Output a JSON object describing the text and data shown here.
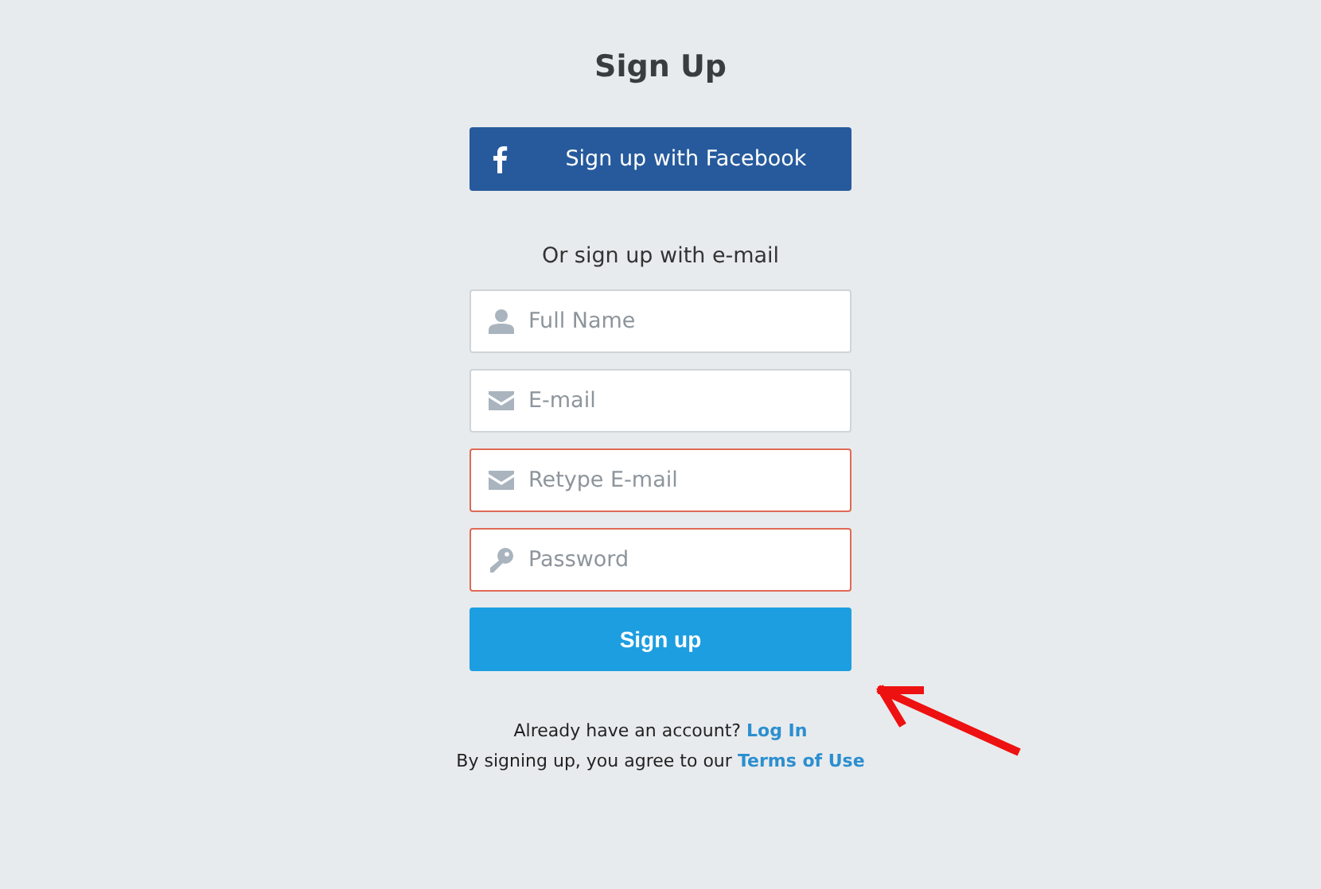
{
  "title": "Sign Up",
  "facebook_button": {
    "kind": "facebook",
    "label": "Sign up with Facebook"
  },
  "divider_text": "Or sign up with e-mail",
  "fields": [
    {
      "kind": "name",
      "placeholder": "Full Name",
      "error": false
    },
    {
      "kind": "email",
      "placeholder": "E-mail",
      "error": false
    },
    {
      "kind": "email",
      "placeholder": "Retype E-mail",
      "error": true
    },
    {
      "kind": "password",
      "placeholder": "Password",
      "error": true
    }
  ],
  "submit_button": "Sign up",
  "footer": [
    {
      "text": "Already have an account?",
      "link": "Log In"
    },
    {
      "text": "By signing up, you agree to our",
      "link": "Terms of Use"
    }
  ],
  "annotation": {
    "kind": "arrow"
  }
}
